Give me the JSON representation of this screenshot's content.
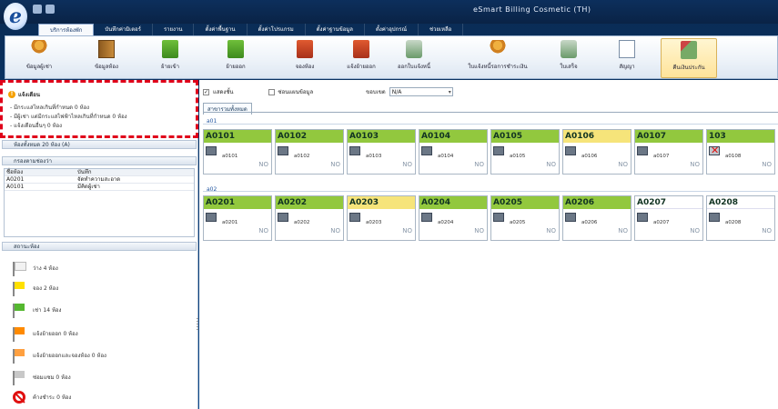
{
  "window": {
    "title": "eSmart Billing Cosmetic (TH)"
  },
  "tabs": [
    "บริการห้องพัก",
    "บันทึกค่ามิเตอร์",
    "รายงาน",
    "ตั้งค่าพื้นฐาน",
    "ตั้งค่าโปรแกรม",
    "ตั้งค่าฐานข้อมูล",
    "ตั้งค่าอุปกรณ์",
    "ช่วยเหลือ"
  ],
  "ribbon": [
    {
      "label": "ข้อมูลผู้เช่า",
      "icon": "people"
    },
    {
      "label": "ข้อมูลห้อง",
      "icon": "door"
    },
    {
      "label": "ย้ายเข้า",
      "icon": "move-in"
    },
    {
      "label": "ย้ายออก",
      "icon": "move-out"
    },
    {
      "label": "จองห้อง",
      "icon": "reserve"
    },
    {
      "label": "แจ้งย้ายออก",
      "icon": "notify-out"
    },
    {
      "label": "ออกใบแจ้งหนี้",
      "icon": "print"
    },
    {
      "label": "ใบแจ้งหนี้รอการชำระเงิน",
      "icon": "invoice-people"
    },
    {
      "label": "ใบเสร็จ",
      "icon": "receipt"
    },
    {
      "label": "สัญญา",
      "icon": "contract"
    },
    {
      "label": "คืนเงินประกัน",
      "icon": "refund"
    }
  ],
  "alerts": {
    "title": "แจ้งเตือน",
    "lines": [
      "- มีกระแสไหลเกินที่กำหนด 0 ห้อง",
      "- มีผู้เช่า แต่มีกระแสไฟฟ้าไหลเกินที่กำหนด 0 ห้อง",
      "- แจ้งเตือนอื่นๆ 0 ห้อง"
    ]
  },
  "room_summary": "ห้องทั้งหมด 20 ห้อง (A)",
  "filter_panel": {
    "title": "กรองตามช่องว่า",
    "columns": [
      "ชื่อห้อง",
      "บันทึก"
    ],
    "rows": [
      [
        "A0201",
        "จัดทำความสะอาด"
      ],
      [
        "A0101",
        "มีคิดผู้เช่า"
      ]
    ]
  },
  "status_panel": {
    "title": "สถานะห้อง",
    "items": [
      {
        "label": "ว่าง 4 ห้อง",
        "flag": "white"
      },
      {
        "label": "จอง 2 ห้อง",
        "flag": "yellow"
      },
      {
        "label": "เช่า 14 ห้อง",
        "flag": "green"
      },
      {
        "label": "แจ้งย้ายออก 0 ห้อง",
        "flag": "orange"
      },
      {
        "label": "แจ้งย้ายออกและจองห้อง 0 ห้อง",
        "flag": "orange2"
      },
      {
        "label": "ซ่อมแซม 0 ห้อง",
        "flag": "gray"
      },
      {
        "label": "ค้างชำระ 0 ห้อง",
        "flag": "nosign"
      }
    ]
  },
  "main": {
    "show_all_label": "แสดงชั้น",
    "hide_label": "ซ่อนแผนข้อมูล",
    "zone_label": "ขอบเขต",
    "zone_value": "N/A",
    "tab_label": "สาขารวมทั้งหมด",
    "floors": [
      {
        "label": "a01",
        "rooms": [
          {
            "name": "A0101",
            "code": "a0101",
            "status": "NO",
            "color": "green"
          },
          {
            "name": "A0102",
            "code": "a0102",
            "status": "NO",
            "color": "green"
          },
          {
            "name": "A0103",
            "code": "a0103",
            "status": "NO",
            "color": "green"
          },
          {
            "name": "A0104",
            "code": "a0104",
            "status": "NO",
            "color": "green"
          },
          {
            "name": "A0105",
            "code": "a0105",
            "status": "NO",
            "color": "green"
          },
          {
            "name": "A0106",
            "code": "a0106",
            "status": "NO",
            "color": "yellow"
          },
          {
            "name": "A0107",
            "code": "a0107",
            "status": "NO",
            "color": "green"
          },
          {
            "name": "103",
            "code": "a0108",
            "status": "NO",
            "color": "green",
            "broken": true
          }
        ]
      },
      {
        "label": "a02",
        "rooms": [
          {
            "name": "A0201",
            "code": "a0201",
            "status": "NO",
            "color": "green"
          },
          {
            "name": "A0202",
            "code": "a0202",
            "status": "NO",
            "color": "green"
          },
          {
            "name": "A0203",
            "code": "a0203",
            "status": "NO",
            "color": "yellow"
          },
          {
            "name": "A0204",
            "code": "a0204",
            "status": "NO",
            "color": "green"
          },
          {
            "name": "A0205",
            "code": "a0205",
            "status": "NO",
            "color": "green"
          },
          {
            "name": "A0206",
            "code": "a0206",
            "status": "NO",
            "color": "green"
          },
          {
            "name": "A0207",
            "code": "a0207",
            "status": "NO",
            "color": "white"
          },
          {
            "name": "A0208",
            "code": "a0208",
            "status": "NO",
            "color": "white"
          }
        ]
      }
    ]
  }
}
